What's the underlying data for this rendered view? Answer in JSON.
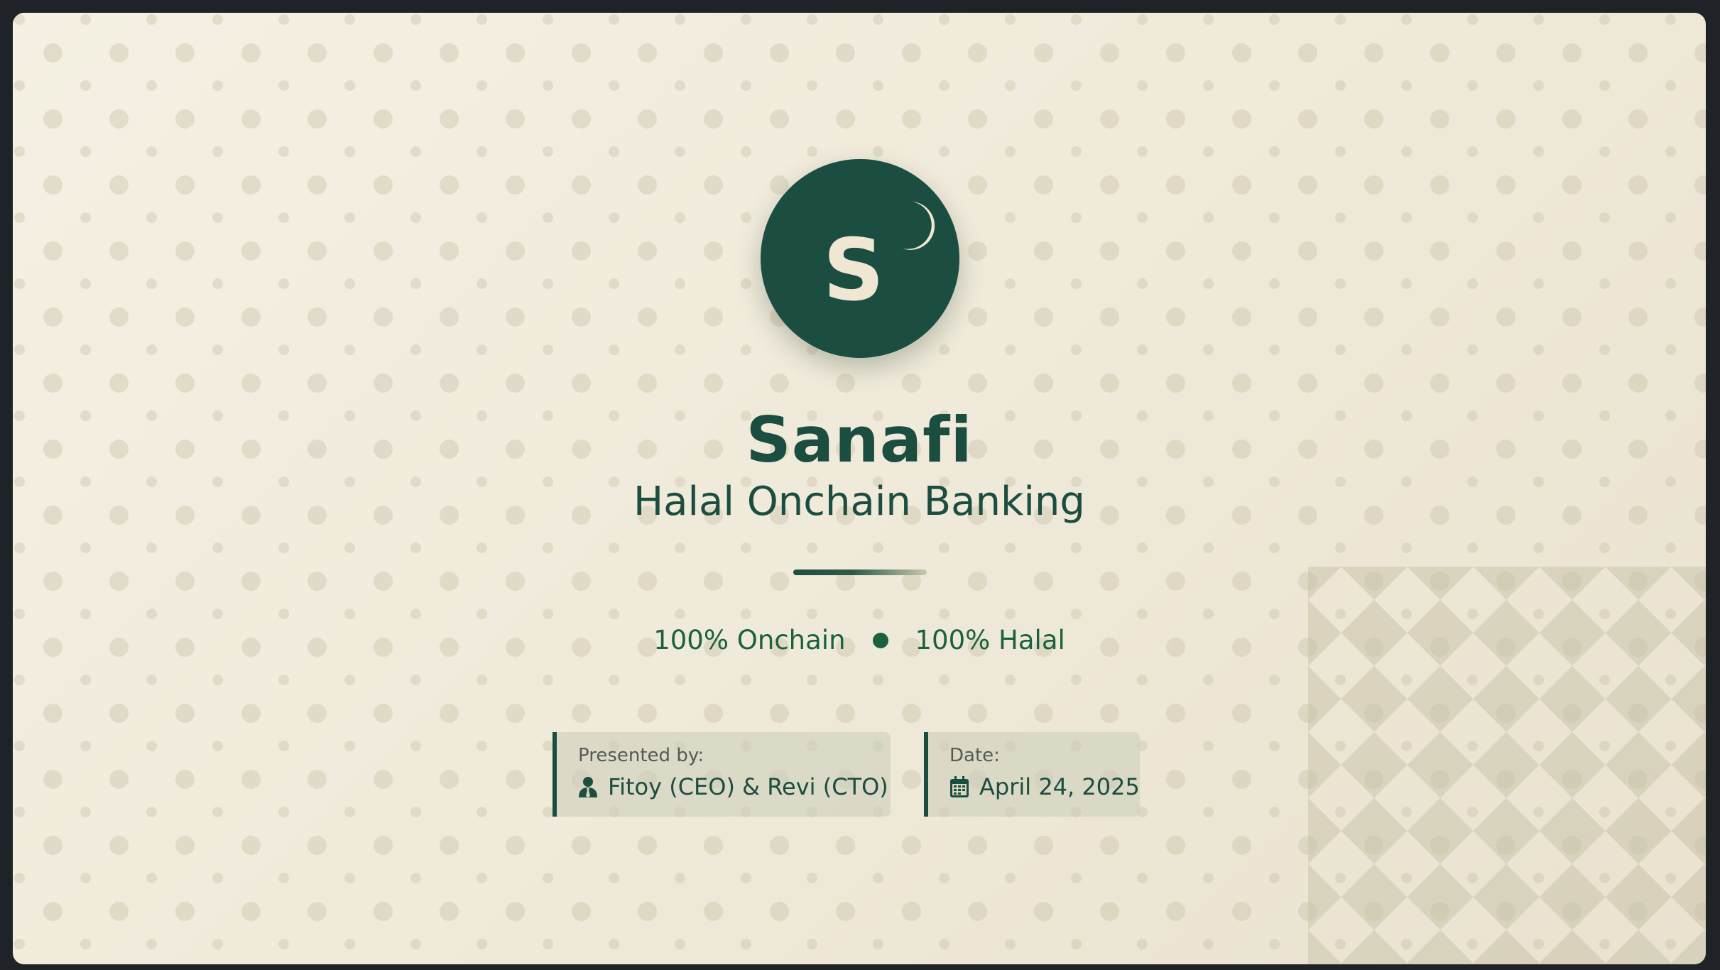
{
  "brand": {
    "logo_letter": "S",
    "name": "Sanafi",
    "tagline": "Halal Onchain Banking"
  },
  "highlights": [
    "100% Onchain",
    "100% Halal"
  ],
  "presenter": {
    "label": "Presented by:",
    "value": "Fitoy (CEO) & Revi (CTO)",
    "icon": "user-tie-icon"
  },
  "date": {
    "label": "Date:",
    "value": "April 24, 2025",
    "icon": "calendar-icon"
  },
  "colors": {
    "primary": "#1b4d40",
    "accent": "#1a6140",
    "background": "#f2ecdd",
    "logo_text": "#efe7d2"
  }
}
